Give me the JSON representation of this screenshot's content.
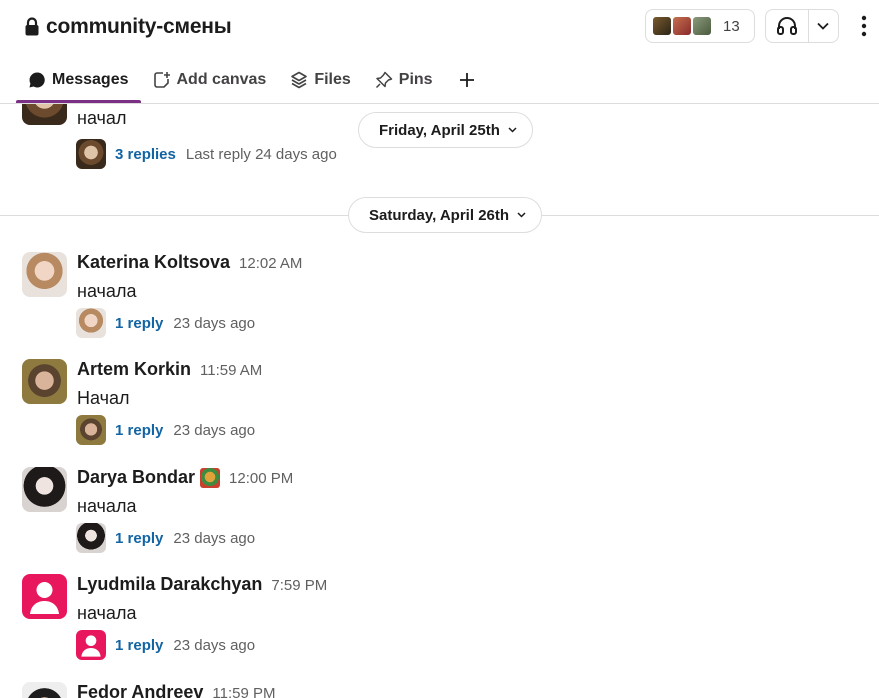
{
  "channel": {
    "name": "community-смены",
    "member_count": "13"
  },
  "tabs": [
    {
      "label": "Messages",
      "icon": "message-icon",
      "active": true
    },
    {
      "label": "Add canvas",
      "icon": "canvas-add-icon"
    },
    {
      "label": "Files",
      "icon": "files-icon"
    },
    {
      "label": "Pins",
      "icon": "pin-icon"
    }
  ],
  "dates": {
    "first": "Friday, April 25th",
    "second": "Saturday, April 26th"
  },
  "colors": {
    "accent": "#7c3085",
    "link": "#1264a3",
    "lyudmila": "#e8175d"
  },
  "messages": [
    {
      "name": "",
      "time": "",
      "text": "начал",
      "replies": "3 replies",
      "last_reply": "Last reply 24 days ago"
    },
    {
      "name": "Katerina Koltsova",
      "time": "12:02 AM",
      "text": "начала",
      "replies": "1 reply",
      "last_reply": "23 days ago"
    },
    {
      "name": "Artem Korkin",
      "time": "11:59 AM",
      "text": "Начал",
      "replies": "1 reply",
      "last_reply": "23 days ago"
    },
    {
      "name": "Darya Bondar",
      "time": "12:00 PM",
      "text": "начала",
      "replies": "1 reply",
      "last_reply": "23 days ago"
    },
    {
      "name": "Lyudmila Darakchyan",
      "time": "7:59 PM",
      "text": "начала",
      "replies": "1 reply",
      "last_reply": "23 days ago"
    },
    {
      "name": "Fedor Andreev",
      "time": "11:59 PM",
      "text": "",
      "replies": "",
      "last_reply": ""
    }
  ]
}
